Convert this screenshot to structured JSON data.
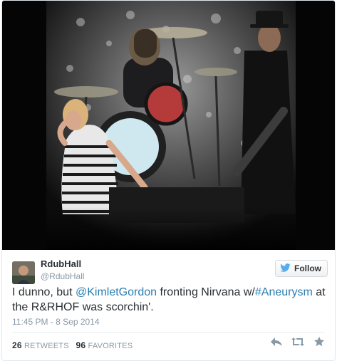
{
  "tweet": {
    "display_name": "RdubHall",
    "screen_name": "@RdubHall",
    "follow_label": "Follow",
    "text": {
      "part1": "I dunno, but ",
      "mention": "@KimletGordon",
      "part2": " fronting Nirvana w/",
      "hashtag": "#Aneurysm",
      "part3": " at the R&RHOF was scorchin'."
    },
    "timestamp": "11:45 PM - 8 Sep 2014",
    "retweets_count": "26",
    "retweets_label": "RETWEETS",
    "favorites_count": "96",
    "favorites_label": "FAVORITES"
  },
  "icons": {
    "follow": "twitter-bird-icon",
    "reply": "reply-icon",
    "retweet": "retweet-icon",
    "favorite": "star-icon"
  },
  "colors": {
    "link": "#2a7db3",
    "muted": "#8899a6",
    "text": "#292f33"
  }
}
